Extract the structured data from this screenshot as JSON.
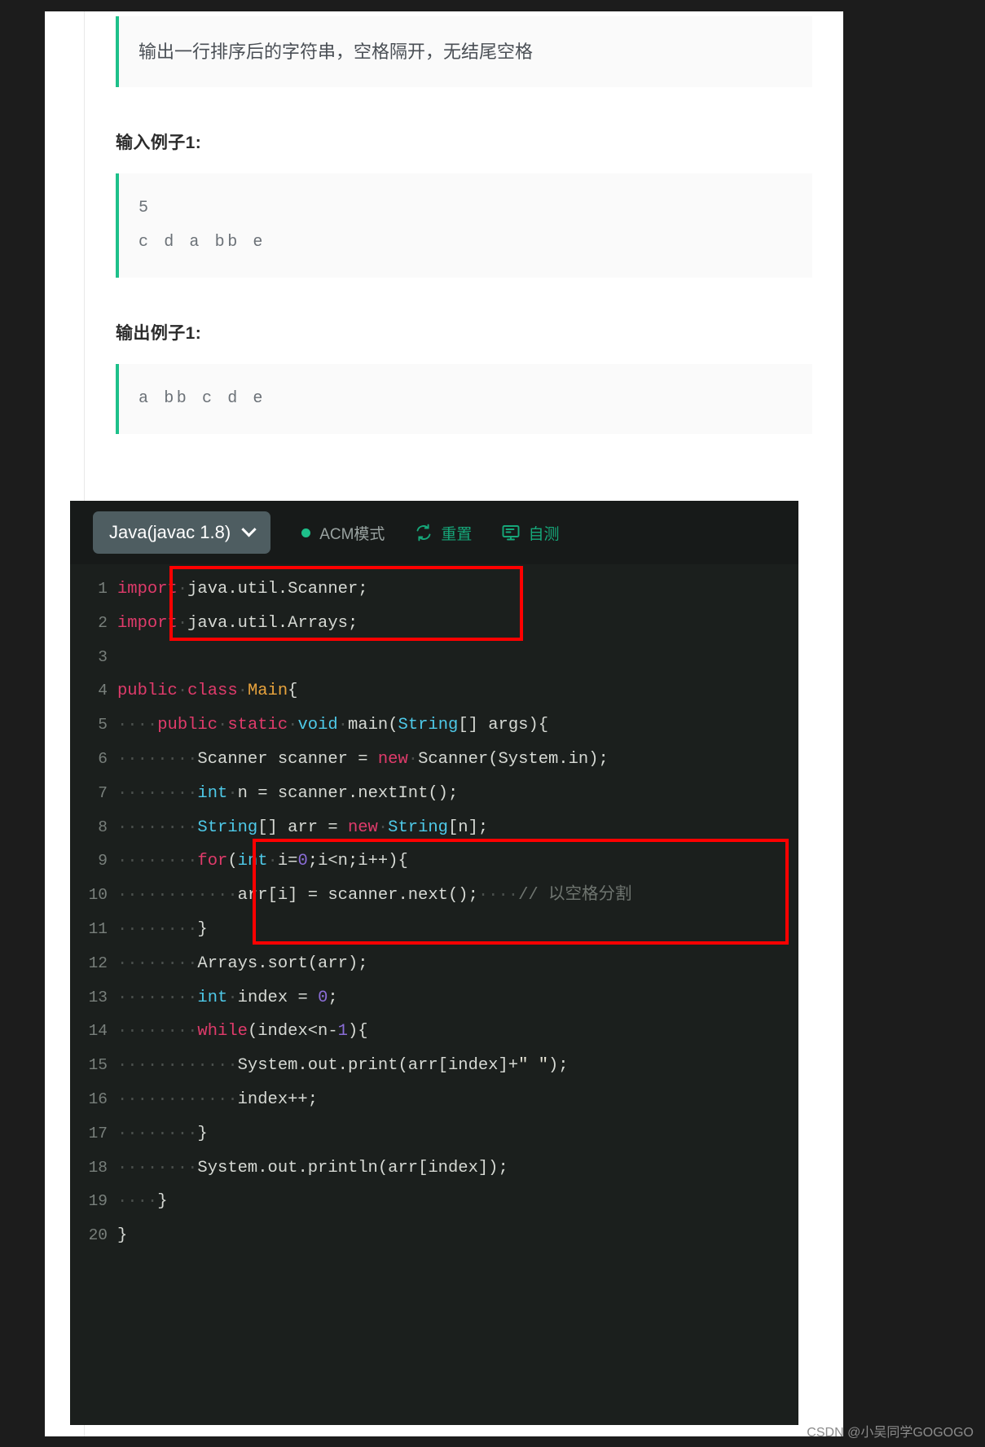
{
  "problem": {
    "description_text": "输出一行排序后的字符串，空格隔开，无结尾空格",
    "input_section_title": "输入例子1:",
    "input_sample_lines": [
      "5",
      "c d a bb e"
    ],
    "output_section_title": "输出例子1:",
    "output_sample_lines": [
      "a bb c d e"
    ]
  },
  "editor": {
    "language_label": "Java(javac 1.8)",
    "mode_label": "ACM模式",
    "reset_label": "重置",
    "selftest_label": "自测",
    "icons": {
      "chevron": "chevron-down-icon",
      "mode_dot": "status-dot-icon",
      "reset": "refresh-icon",
      "selftest": "monitor-icon"
    },
    "colors": {
      "editor_bg": "#1b1f1d",
      "toolbar_bg": "#171a19",
      "accent_green": "#16a87a",
      "keyword": "#e03b6b",
      "type": "#4ec9e8",
      "class": "#e8a33d",
      "number": "#8a6dd6",
      "comment": "#6f7570",
      "plain": "#d6d9d4",
      "annotation_red": "#ff0000",
      "quote_green": "#1ec08a"
    },
    "lines": [
      {
        "no": "1",
        "tokens": [
          {
            "t": "import",
            "c": "kw"
          },
          {
            "t": " ",
            "c": "dot-sp"
          },
          {
            "t": "java.util.Scanner;",
            "c": "lc"
          }
        ]
      },
      {
        "no": "2",
        "tokens": [
          {
            "t": "import",
            "c": "kw"
          },
          {
            "t": " ",
            "c": "dot-sp"
          },
          {
            "t": "java.util.Arrays;",
            "c": "lc"
          }
        ]
      },
      {
        "no": "3",
        "tokens": []
      },
      {
        "no": "4",
        "tokens": [
          {
            "t": "public",
            "c": "kw"
          },
          {
            "t": " ",
            "c": "dot-sp"
          },
          {
            "t": "class",
            "c": "kw"
          },
          {
            "t": " ",
            "c": "dot-sp"
          },
          {
            "t": "Main",
            "c": "cls"
          },
          {
            "t": "{",
            "c": "lc"
          }
        ]
      },
      {
        "no": "5",
        "tokens": [
          {
            "t": "    ",
            "c": "dot-sp"
          },
          {
            "t": "public",
            "c": "kw"
          },
          {
            "t": " ",
            "c": "dot-sp"
          },
          {
            "t": "static",
            "c": "kw"
          },
          {
            "t": " ",
            "c": "dot-sp"
          },
          {
            "t": "void",
            "c": "typ"
          },
          {
            "t": " ",
            "c": "dot-sp"
          },
          {
            "t": "main(",
            "c": "lc"
          },
          {
            "t": "String",
            "c": "typ"
          },
          {
            "t": "[] ",
            "c": "lc"
          },
          {
            "t": "args){",
            "c": "lc"
          }
        ]
      },
      {
        "no": "6",
        "tokens": [
          {
            "t": "        ",
            "c": "dot-sp"
          },
          {
            "t": "Scanner scanner = ",
            "c": "lc"
          },
          {
            "t": "new",
            "c": "kw"
          },
          {
            "t": " ",
            "c": "dot-sp"
          },
          {
            "t": "Scanner(System.in);",
            "c": "lc"
          }
        ]
      },
      {
        "no": "7",
        "tokens": [
          {
            "t": "        ",
            "c": "dot-sp"
          },
          {
            "t": "int",
            "c": "typ"
          },
          {
            "t": " ",
            "c": "dot-sp"
          },
          {
            "t": "n = scanner.nextInt();",
            "c": "lc"
          }
        ]
      },
      {
        "no": "8",
        "tokens": [
          {
            "t": "        ",
            "c": "dot-sp"
          },
          {
            "t": "String",
            "c": "typ"
          },
          {
            "t": "[] ",
            "c": "lc"
          },
          {
            "t": "arr = ",
            "c": "lc"
          },
          {
            "t": "new",
            "c": "kw"
          },
          {
            "t": " ",
            "c": "dot-sp"
          },
          {
            "t": "String",
            "c": "typ"
          },
          {
            "t": "[n];",
            "c": "lc"
          }
        ]
      },
      {
        "no": "9",
        "tokens": [
          {
            "t": "        ",
            "c": "dot-sp"
          },
          {
            "t": "for",
            "c": "kw"
          },
          {
            "t": "(",
            "c": "lc"
          },
          {
            "t": "int",
            "c": "typ"
          },
          {
            "t": " ",
            "c": "dot-sp"
          },
          {
            "t": "i=",
            "c": "lc"
          },
          {
            "t": "0",
            "c": "num"
          },
          {
            "t": ";i<n;i++){",
            "c": "lc"
          }
        ]
      },
      {
        "no": "10",
        "tokens": [
          {
            "t": "            ",
            "c": "dot-sp"
          },
          {
            "t": "arr[i] = scanner.next();",
            "c": "lc"
          },
          {
            "t": "    ",
            "c": "dot-sp"
          },
          {
            "t": "// 以空格分割",
            "c": "cmt"
          }
        ]
      },
      {
        "no": "11",
        "tokens": [
          {
            "t": "        ",
            "c": "dot-sp"
          },
          {
            "t": "}",
            "c": "lc"
          }
        ]
      },
      {
        "no": "12",
        "tokens": [
          {
            "t": "        ",
            "c": "dot-sp"
          },
          {
            "t": "Arrays.sort(arr);",
            "c": "lc"
          }
        ]
      },
      {
        "no": "13",
        "tokens": [
          {
            "t": "        ",
            "c": "dot-sp"
          },
          {
            "t": "int",
            "c": "typ"
          },
          {
            "t": " ",
            "c": "dot-sp"
          },
          {
            "t": "index = ",
            "c": "lc"
          },
          {
            "t": "0",
            "c": "num"
          },
          {
            "t": ";",
            "c": "lc"
          }
        ]
      },
      {
        "no": "14",
        "tokens": [
          {
            "t": "        ",
            "c": "dot-sp"
          },
          {
            "t": "while",
            "c": "kw"
          },
          {
            "t": "(index<n-",
            "c": "lc"
          },
          {
            "t": "1",
            "c": "num"
          },
          {
            "t": "){",
            "c": "lc"
          }
        ]
      },
      {
        "no": "15",
        "tokens": [
          {
            "t": "            ",
            "c": "dot-sp"
          },
          {
            "t": "System.out.print(arr[index]+",
            "c": "lc"
          },
          {
            "t": "\" \"",
            "c": "str"
          },
          {
            "t": ");",
            "c": "lc"
          }
        ]
      },
      {
        "no": "16",
        "tokens": [
          {
            "t": "            ",
            "c": "dot-sp"
          },
          {
            "t": "index++;",
            "c": "lc"
          }
        ]
      },
      {
        "no": "17",
        "tokens": [
          {
            "t": "        ",
            "c": "dot-sp"
          },
          {
            "t": "}",
            "c": "lc"
          }
        ]
      },
      {
        "no": "18",
        "tokens": [
          {
            "t": "        ",
            "c": "dot-sp"
          },
          {
            "t": "System.out.println(arr[index]);",
            "c": "lc"
          }
        ]
      },
      {
        "no": "19",
        "tokens": [
          {
            "t": "    ",
            "c": "dot-sp"
          },
          {
            "t": "}",
            "c": "lc"
          }
        ]
      },
      {
        "no": "20",
        "tokens": [
          {
            "t": "}",
            "c": "lc"
          }
        ]
      }
    ]
  },
  "watermark": "CSDN @小吴同学GOGOGO"
}
